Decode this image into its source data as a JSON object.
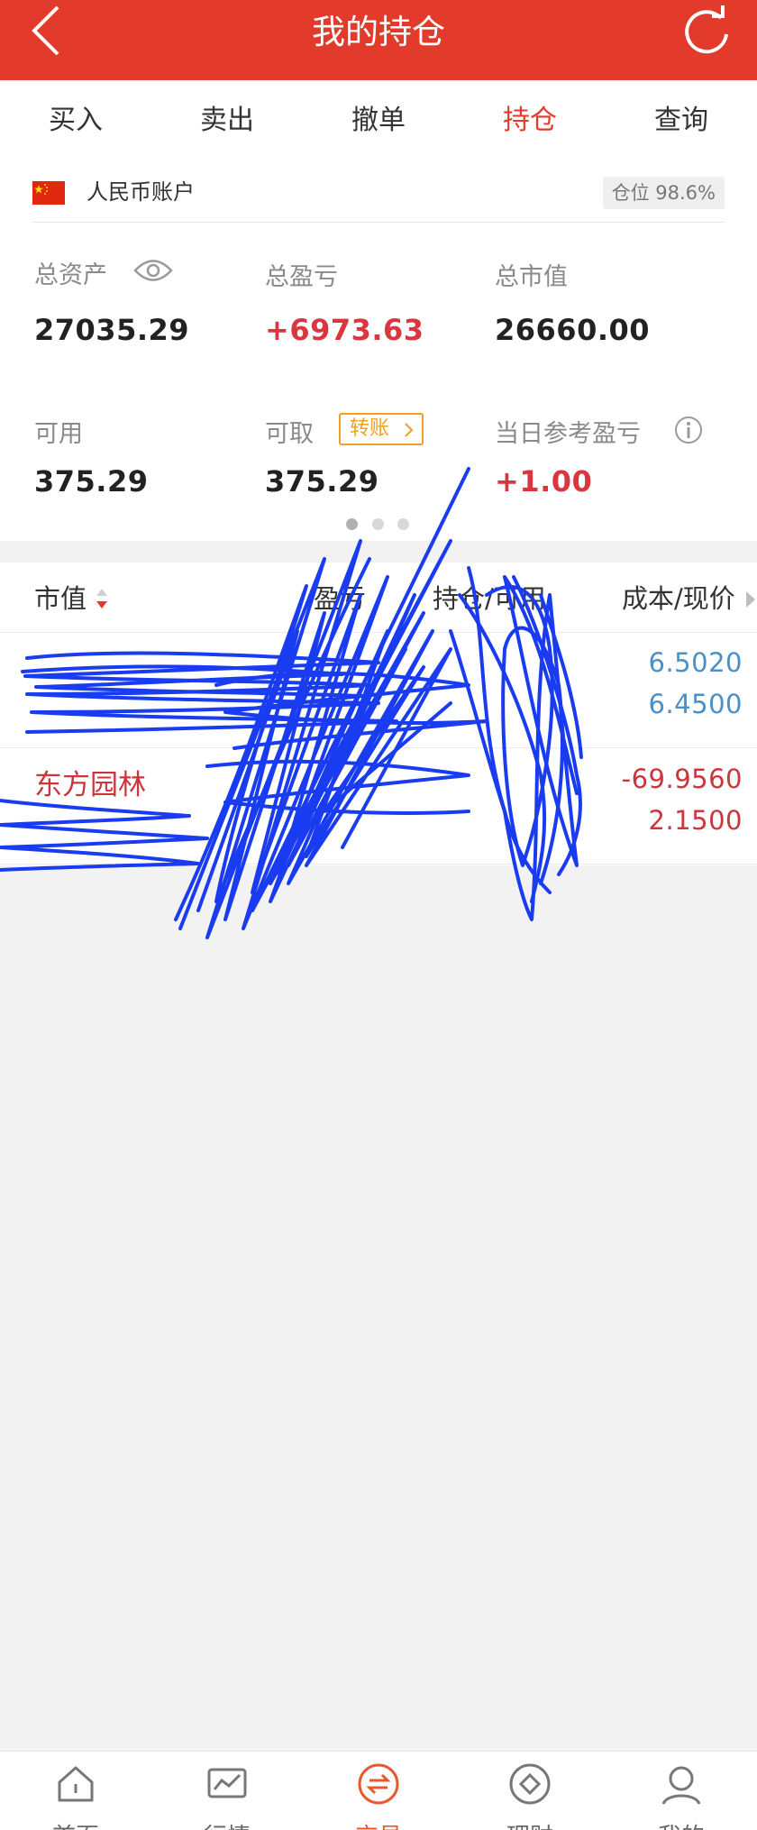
{
  "header": {
    "title": "我的持仓"
  },
  "tabs": [
    {
      "label": "买入"
    },
    {
      "label": "卖出"
    },
    {
      "label": "撤单"
    },
    {
      "label": "持仓"
    },
    {
      "label": "查询"
    }
  ],
  "account": {
    "name": "人民币账户",
    "position_ratio": "仓位 98.6%"
  },
  "metrics": {
    "total_assets_label": "总资产",
    "total_assets": "27035.29",
    "total_pnl_label": "总盈亏",
    "total_pnl": "+6973.63",
    "market_value_label": "总市值",
    "market_value": "26660.00",
    "available_label": "可用",
    "available": "375.29",
    "withdrawable_label": "可取",
    "withdrawable": "375.29",
    "transfer_label": "转账",
    "daily_pnl_label": "当日参考盈亏",
    "daily_pnl": "+1.00"
  },
  "list": {
    "columns": [
      "市值",
      "盈亏",
      "持仓/可用",
      "成本/现价"
    ],
    "rows": [
      {
        "name": "",
        "cost": "6.5020",
        "price": "6.4500",
        "color": "#4a90c8"
      },
      {
        "name": "东方园林",
        "cost": "-69.9560",
        "price": "2.1500",
        "color": "#c9373c"
      }
    ]
  },
  "bottom_nav": [
    {
      "label": "首页",
      "icon": "home-icon"
    },
    {
      "label": "行情",
      "icon": "chart-icon"
    },
    {
      "label": "交易",
      "icon": "trade-icon"
    },
    {
      "label": "理财",
      "icon": "finance-icon"
    },
    {
      "label": "我的",
      "icon": "user-icon"
    }
  ],
  "colors": {
    "header": "#e23a2b",
    "active_tab": "#e23a2b",
    "scribble": "#1a3cf0",
    "nav_active": "#e8592c"
  }
}
